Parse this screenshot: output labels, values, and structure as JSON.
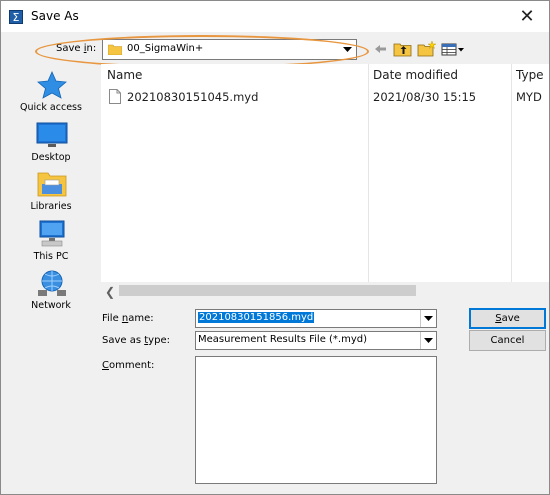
{
  "window": {
    "title": "Save As",
    "close_glyph": "✕"
  },
  "toolbar": {
    "save_in_label": "Save in:",
    "save_in_value": "00_SigmaWin+",
    "icons": [
      "back-arrow-icon",
      "up-folder-icon",
      "new-folder-icon",
      "view-menu-icon"
    ]
  },
  "places": [
    {
      "label": "Quick access",
      "icon": "star-icon"
    },
    {
      "label": "Desktop",
      "icon": "desktop-icon"
    },
    {
      "label": "Libraries",
      "icon": "libraries-icon"
    },
    {
      "label": "This PC",
      "icon": "computer-icon"
    },
    {
      "label": "Network",
      "icon": "network-icon"
    }
  ],
  "file_list": {
    "columns": [
      "Name",
      "Date modified",
      "Type"
    ],
    "rows": [
      {
        "name": "20210830151045.myd",
        "date": "2021/08/30 15:15",
        "type": "MYD"
      }
    ]
  },
  "form": {
    "file_name_label": "File name:",
    "file_name_value": "20210830151856.myd",
    "save_as_type_label": "Save as type:",
    "save_as_type_value": "Measurement Results File (*.myd)",
    "comment_label": "Comment:"
  },
  "buttons": {
    "save": "Save",
    "cancel": "Cancel"
  },
  "colors": {
    "accent": "#0078d7",
    "highlight_oval": "#e8963f",
    "folder": "#f5c542"
  }
}
